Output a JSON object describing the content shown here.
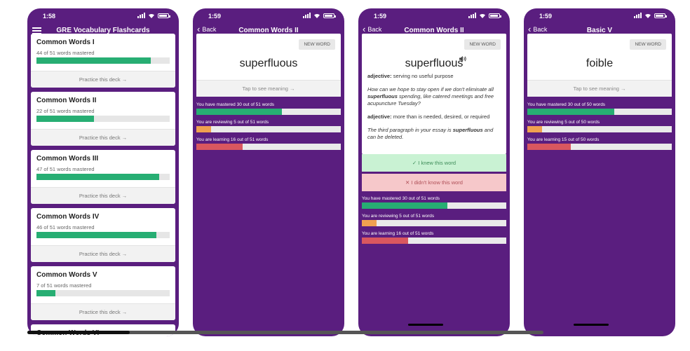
{
  "status_times": [
    "1:58",
    "1:59",
    "1:59",
    "1:59"
  ],
  "deck_list": {
    "title": "GRE Vocabulary Flashcards",
    "decks": [
      {
        "title": "Common Words I",
        "subtitle": "44 of 51 words mastered",
        "progress": 0.86,
        "practice": "Practice this deck →"
      },
      {
        "title": "Common Words II",
        "subtitle": "22 of 51 words mastered",
        "progress": 0.43,
        "practice": "Practice this deck →"
      },
      {
        "title": "Common Words III",
        "subtitle": "47 of 51 words mastered",
        "progress": 0.92,
        "practice": "Practice this deck →"
      },
      {
        "title": "Common Words IV",
        "subtitle": "46 of 51 words mastered",
        "progress": 0.9,
        "practice": "Practice this deck →"
      },
      {
        "title": "Common Words V",
        "subtitle": "7 of 51 words mastered",
        "progress": 0.14,
        "practice": "Practice this deck →"
      },
      {
        "title": "Common Words VI",
        "subtitle": "",
        "progress": 0,
        "practice": ""
      }
    ]
  },
  "screen2": {
    "back": "Back",
    "title": "Common Words II",
    "new_word": "NEW WORD",
    "word": "superfluous",
    "tap": "Tap to see meaning →",
    "stats": [
      {
        "label": "You have mastered 30 out of 51 words",
        "value": 0.59,
        "color": "#27ae73"
      },
      {
        "label": "You are reviewing 5 out of 51 words",
        "value": 0.1,
        "color": "#f0a050"
      },
      {
        "label": "You are learning 16 out of 51 words",
        "value": 0.32,
        "color": "#d9575f"
      }
    ]
  },
  "screen3": {
    "back": "Back",
    "title": "Common Words II",
    "new_word": "NEW WORD",
    "word": "superfluous",
    "def1_pos": "adjective:",
    "def1_text": " serving no useful purpose",
    "ex1_a": "How can we hope to stay open if we don't eliminate all ",
    "ex1_b": "superfluous",
    "ex1_c": " spending, like catered meetings and free acupuncture Tuesday?",
    "def2_pos": "adjective:",
    "def2_text": " more than is needed, desired, or required",
    "ex2_a": "The third paragraph in your essay is ",
    "ex2_b": "superfluous",
    "ex2_c": " and can be deleted.",
    "knew": "✓ I knew this word",
    "didnt": "✕ I didn't know this word",
    "stats": [
      {
        "label": "You have mastered 30 out of 51 words",
        "value": 0.59,
        "color": "#27ae73"
      },
      {
        "label": "You are reviewing 5 out of 51 words",
        "value": 0.1,
        "color": "#f0a050"
      },
      {
        "label": "You are learning 16 out of 51 words",
        "value": 0.32,
        "color": "#d9575f"
      }
    ]
  },
  "screen4": {
    "back": "Back",
    "title": "Basic V",
    "new_word": "NEW WORD",
    "word": "foible",
    "tap": "Tap to see meaning →",
    "stats": [
      {
        "label": "You have mastered 30 out of 50 words",
        "value": 0.6,
        "color": "#27ae73"
      },
      {
        "label": "You are reviewing 5 out of 50 words",
        "value": 0.1,
        "color": "#f0a050"
      },
      {
        "label": "You are learning 15 out of 50 words",
        "value": 0.3,
        "color": "#d9575f"
      }
    ]
  }
}
